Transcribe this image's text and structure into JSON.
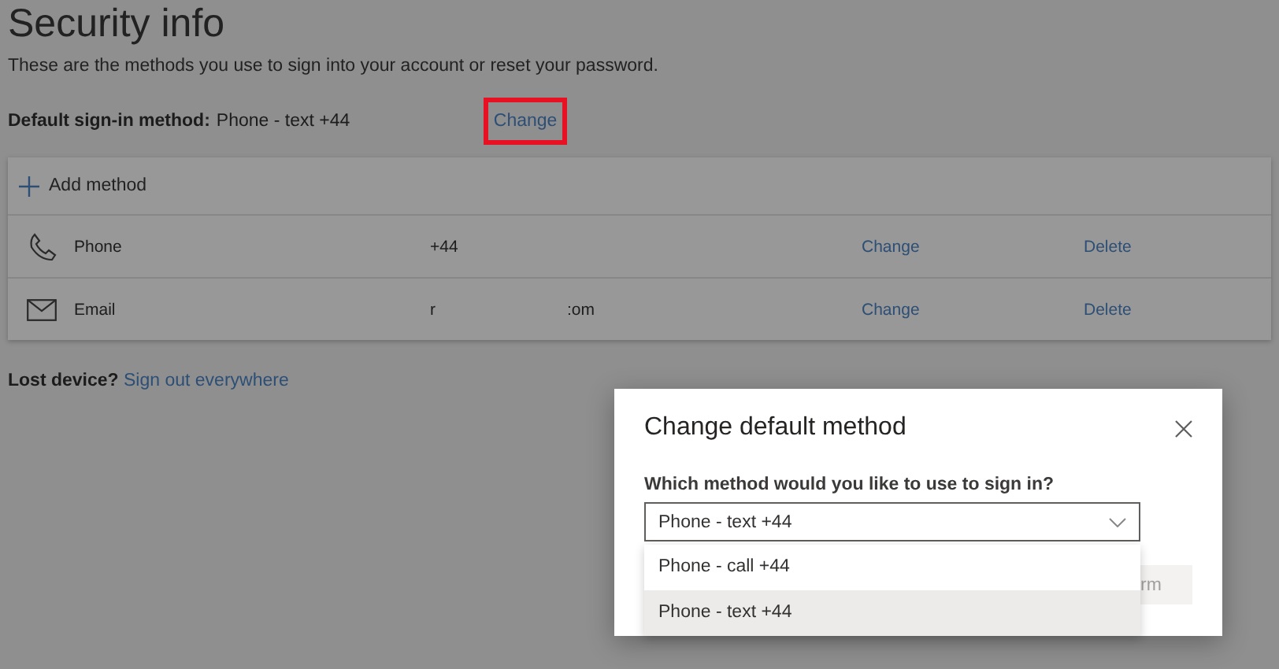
{
  "page": {
    "title": "Security info",
    "subtitle": "These are the methods you use to sign into your account or reset your password.",
    "default_method": {
      "label": "Default sign-in method:",
      "value": "Phone - text +44",
      "change_link": "Change",
      "highlighted": true
    },
    "add_method": "Add method",
    "methods": [
      {
        "kind": "phone",
        "name": "Phone",
        "value": [
          "+44"
        ],
        "change": "Change",
        "delete": "Delete"
      },
      {
        "kind": "email",
        "name": "Email",
        "value": [
          "r",
          ":om"
        ],
        "change": "Change",
        "delete": "Delete"
      }
    ],
    "lost_device": {
      "label": "Lost device?",
      "link": "Sign out everywhere"
    }
  },
  "dialog": {
    "title": "Change default method",
    "question": "Which method would you like to use to sign in?",
    "select_value": "Phone - text +44",
    "options": [
      {
        "label": "Phone - call +44",
        "selected": false
      },
      {
        "label": "Phone - text +44",
        "selected": true
      }
    ],
    "confirm_button": "rm"
  }
}
